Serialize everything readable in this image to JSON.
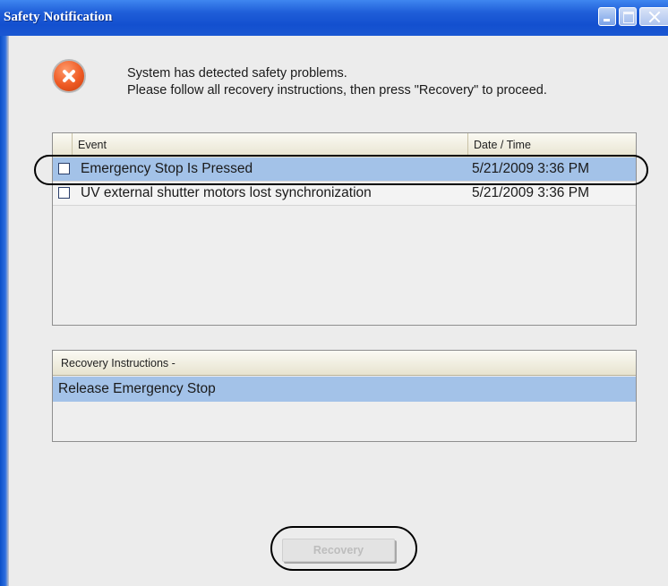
{
  "window": {
    "title": "Safety Notification",
    "controls": {
      "minimize_icon": "minimize-icon",
      "maximize_icon": "maximize-icon",
      "close_icon": "close-icon"
    }
  },
  "message": {
    "icon": "error-icon",
    "line1": "System has detected safety problems.",
    "line2": "Please follow all recovery instructions, then press \"Recovery\" to proceed."
  },
  "events": {
    "columns": {
      "event": "Event",
      "date": "Date / Time"
    },
    "rows": [
      {
        "event": "Emergency Stop Is Pressed",
        "date": "5/21/2009 3:36 PM",
        "selected": true,
        "checked": false
      },
      {
        "event": "UV external shutter motors lost synchronization",
        "date": "5/21/2009 3:36 PM",
        "selected": false,
        "checked": false
      }
    ]
  },
  "instructions": {
    "header": "Recovery Instructions -",
    "items": [
      "Release Emergency Stop"
    ]
  },
  "actions": {
    "recovery_label": "Recovery",
    "recovery_enabled": false
  },
  "colors": {
    "titlebar": "#1350cf",
    "selection": "#a3c2e8",
    "header_bg": "#e7e3cf",
    "error": "#ee5a24"
  }
}
